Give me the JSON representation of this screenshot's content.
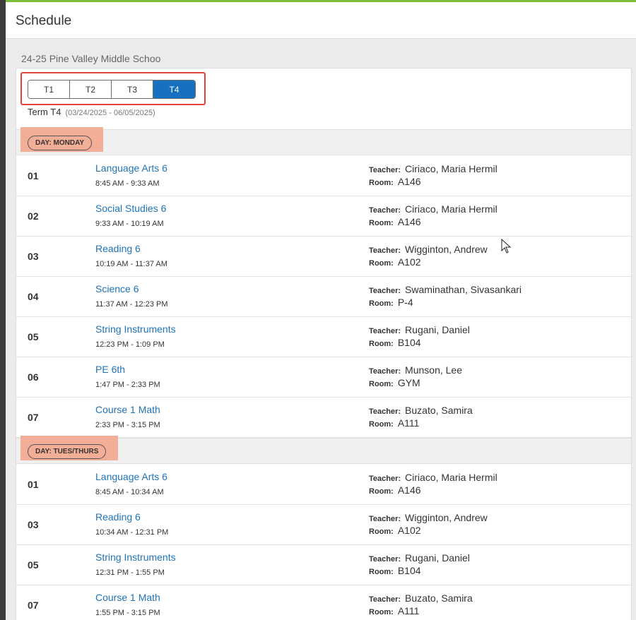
{
  "header": {
    "title": "Schedule"
  },
  "school": "24-25 Pine Valley Middle Schoo",
  "terms": {
    "tabs": [
      {
        "label": "T1",
        "active": false
      },
      {
        "label": "T2",
        "active": false
      },
      {
        "label": "T3",
        "active": false
      },
      {
        "label": "T4",
        "active": true
      }
    ],
    "current_label": "Term T4",
    "current_dates": "(03/24/2025 - 06/05/2025)"
  },
  "labels": {
    "teacher": "Teacher:",
    "room": "Room:"
  },
  "days": [
    {
      "name": "DAY: MONDAY",
      "periods": [
        {
          "num": "01",
          "course": "Language Arts 6",
          "time": "8:45 AM - 9:33 AM",
          "teacher": "Ciriaco, Maria Hermil",
          "room": "A146"
        },
        {
          "num": "02",
          "course": "Social Studies 6",
          "time": "9:33 AM - 10:19 AM",
          "teacher": "Ciriaco, Maria Hermil",
          "room": "A146"
        },
        {
          "num": "03",
          "course": "Reading 6",
          "time": "10:19 AM - 11:37 AM",
          "teacher": "Wigginton, Andrew",
          "room": "A102"
        },
        {
          "num": "04",
          "course": "Science 6",
          "time": "11:37 AM - 12:23 PM",
          "teacher": "Swaminathan, Sivasankari",
          "room": "P-4"
        },
        {
          "num": "05",
          "course": "String Instruments",
          "time": "12:23 PM - 1:09 PM",
          "teacher": "Rugani, Daniel",
          "room": "B104"
        },
        {
          "num": "06",
          "course": "PE 6th",
          "time": "1:47 PM - 2:33 PM",
          "teacher": "Munson, Lee",
          "room": "GYM"
        },
        {
          "num": "07",
          "course": "Course 1 Math",
          "time": "2:33 PM - 3:15 PM",
          "teacher": "Buzato, Samira",
          "room": "A111"
        }
      ]
    },
    {
      "name": "DAY: TUES/THURS",
      "periods": [
        {
          "num": "01",
          "course": "Language Arts 6",
          "time": "8:45 AM - 10:34 AM",
          "teacher": "Ciriaco, Maria Hermil",
          "room": "A146"
        },
        {
          "num": "03",
          "course": "Reading 6",
          "time": "10:34 AM - 12:31 PM",
          "teacher": "Wigginton, Andrew",
          "room": "A102"
        },
        {
          "num": "05",
          "course": "String Instruments",
          "time": "12:31 PM - 1:55 PM",
          "teacher": "Rugani, Daniel",
          "room": "B104"
        },
        {
          "num": "07",
          "course": "Course 1 Math",
          "time": "1:55 PM - 3:15 PM",
          "teacher": "Buzato, Samira",
          "room": "A111"
        }
      ]
    }
  ]
}
